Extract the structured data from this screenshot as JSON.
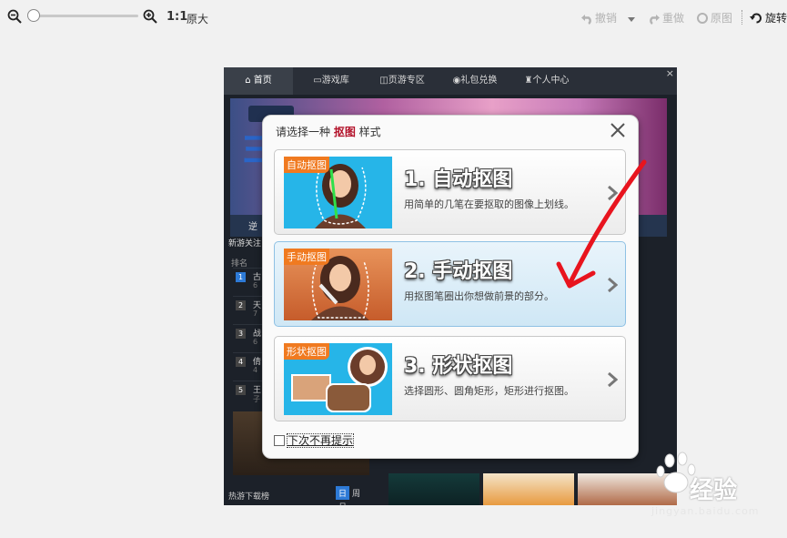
{
  "toolbar": {
    "zoom": {
      "level_fraction": 0.0
    },
    "ratio_label": "1:1",
    "original_size_label": "原大",
    "undo_label": "撤销",
    "redo_label": "重做",
    "original_label": "原图",
    "rotate_label": "旋转"
  },
  "client": {
    "nav_tabs": [
      "首页",
      "游戏库",
      "页游专区",
      "礼包兑换",
      "个人中心"
    ],
    "left_panel": {
      "title": "新游关注",
      "rank_header": "排名",
      "ranks": [
        {
          "num": "1",
          "name": "古",
          "sub": "6"
        },
        {
          "num": "2",
          "name": "天",
          "sub": "7"
        },
        {
          "num": "3",
          "name": "战",
          "sub": "6"
        },
        {
          "num": "4",
          "name": "倩",
          "sub": "4"
        },
        {
          "num": "5",
          "name": "王",
          "sub": "子"
        }
      ],
      "footer_title": "热游下载榜",
      "footer_tabs": [
        "日",
        "周",
        "月"
      ]
    },
    "banner_band_text": "逆"
  },
  "dialog": {
    "title_prefix": "请选择一种 ",
    "title_keyword": "抠图",
    "title_suffix": " 样式",
    "options": [
      {
        "tag": "自动抠图",
        "title": "1. 自动抠图",
        "desc": "用简单的几笔在要抠取的图像上划线。",
        "selected": false
      },
      {
        "tag": "手动抠图",
        "title": "2. 手动抠图",
        "desc": "用抠图笔圈出你想做前景的部分。",
        "selected": true
      },
      {
        "tag": "形状抠图",
        "title": "3. 形状抠图",
        "desc": "选择圆形、圆角矩形，矩形进行抠图。",
        "selected": false
      }
    ],
    "checkbox_label": "下次不再提示",
    "checkbox_checked": false
  },
  "watermark": {
    "text": "经验",
    "url": "jingyan.baidu.com"
  },
  "colors": {
    "accent_red": "#b3122a",
    "tag_orange": "#f07a20",
    "selected_blue": "#cfe7f5"
  }
}
